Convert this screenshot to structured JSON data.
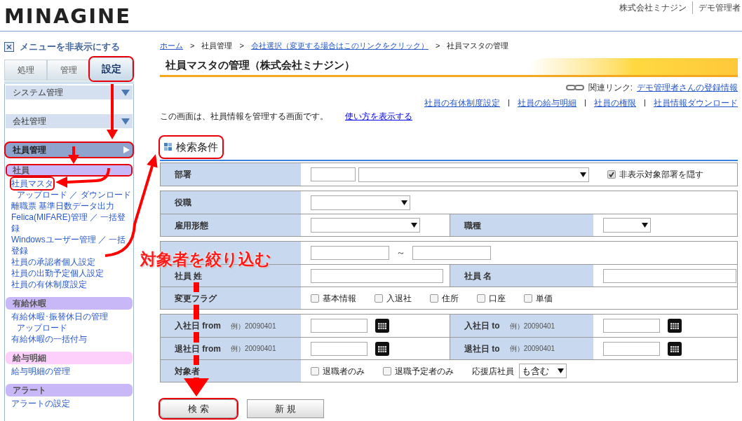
{
  "header": {
    "logo": "MINAGINE",
    "company": "株式会社ミナジン",
    "user": "デモ管理者"
  },
  "sidebar": {
    "hide_menu": "メニューを非表示にする",
    "tabs": [
      {
        "label": "処理",
        "selected": false,
        "highlighted": false
      },
      {
        "label": "管理",
        "selected": false,
        "highlighted": false
      },
      {
        "label": "設定",
        "selected": true,
        "highlighted": true
      }
    ],
    "menus": [
      {
        "label": "システム管理",
        "selected": false,
        "highlighted": false
      },
      {
        "label": "会社管理",
        "selected": false,
        "highlighted": false
      },
      {
        "label": "社員管理",
        "selected": true,
        "highlighted": true
      }
    ],
    "categories": [
      {
        "title": "社員",
        "color": "#c9b8f8",
        "highlighted": true,
        "items": [
          {
            "label": "社員マスタ",
            "highlighted": true,
            "children": [
              {
                "label": "アップロード ／ ダウンロード"
              }
            ]
          },
          {
            "label": "離職票 基準日数データ出力"
          },
          {
            "label": "Felica(MIFARE)管理 ／ 一括登録"
          },
          {
            "label": "Windowsユーザー管理 ／ 一括登録"
          },
          {
            "label": "社員の承認者個人設定"
          },
          {
            "label": "社員の出勤予定個人設定"
          },
          {
            "label": "社員の有休制度設定"
          }
        ]
      },
      {
        "title": "有給休暇",
        "color": "#c9b8f8",
        "highlighted": false,
        "items": [
          {
            "label": "有給休暇･振替休日の管理",
            "children": [
              {
                "label": "アップロード"
              }
            ]
          },
          {
            "label": "有給休暇の一括付与"
          }
        ]
      },
      {
        "title": "給与明細",
        "color": "#fcd0fa",
        "highlighted": false,
        "items": [
          {
            "label": "給与明細の管理"
          }
        ]
      },
      {
        "title": "アラート",
        "color": "#c9b8f8",
        "highlighted": false,
        "items": [
          {
            "label": "アラートの設定"
          }
        ]
      }
    ]
  },
  "breadcrumb": {
    "separator": ">",
    "items": [
      {
        "label": "ホーム",
        "link": true
      },
      {
        "label": "社員管理",
        "link": false
      },
      {
        "label": "会社選択（変更する場合はこのリンクをクリック）",
        "link": true
      },
      {
        "label": "社員マスタの管理",
        "link": false
      }
    ]
  },
  "page_title": "社員マスタの管理（株式会社ミナジン）",
  "related": {
    "label": "関連リンク:",
    "link": "デモ管理者さんの登録情報",
    "links": [
      "社員の有休制度設定",
      "社員の給与明細",
      "社員の権限",
      "社員情報ダウンロード"
    ]
  },
  "description": {
    "text": "この画面は、社員情報を管理する画面です。",
    "link": "使い方を表示する"
  },
  "search": {
    "title": "検索条件",
    "highlighted": true,
    "groups": [
      {
        "rows": [
          {
            "fields": [
              {
                "label": "部署",
                "controls": [
                  {
                    "kind": "input"
                  },
                  {
                    "kind": "select"
                  },
                  {
                    "kind": "checkbox",
                    "label": "非表示対象部署を隠す",
                    "checked": true
                  }
                ]
              }
            ]
          }
        ]
      },
      {
        "rows": [
          {
            "fields": [
              {
                "label": "役職",
                "controls": [
                  {
                    "kind": "select"
                  }
                ]
              }
            ]
          },
          {
            "fields": [
              {
                "label": "雇用形態",
                "controls": [
                  {
                    "kind": "select"
                  }
                ]
              },
              {
                "label": "職種",
                "controls": [
                  {
                    "kind": "select"
                  }
                ]
              }
            ]
          }
        ]
      },
      {
        "rows": [
          {
            "fields": [
              {
                "controls": [
                  {
                    "kind": "input"
                  },
                  {
                    "kind": "separator",
                    "text": "～"
                  },
                  {
                    "kind": "input"
                  }
                ]
              }
            ]
          },
          {
            "fields": [
              {
                "label": "社員 姓",
                "controls": [
                  {
                    "kind": "input"
                  }
                ]
              },
              {
                "label": "社員 名",
                "controls": [
                  {
                    "kind": "input"
                  }
                ]
              }
            ]
          },
          {
            "fields": [
              {
                "label": "変更フラグ",
                "controls": [
                  {
                    "kind": "checkbox",
                    "label": "基本情報",
                    "checked": false
                  },
                  {
                    "kind": "checkbox",
                    "label": "入退社",
                    "checked": false
                  },
                  {
                    "kind": "checkbox",
                    "label": "住所",
                    "checked": false
                  },
                  {
                    "kind": "checkbox",
                    "label": "口座",
                    "checked": false
                  },
                  {
                    "kind": "checkbox",
                    "label": "単価",
                    "checked": false
                  }
                ]
              }
            ]
          }
        ]
      },
      {
        "rows": [
          {
            "fields": [
              {
                "label": "入社日 from",
                "example": "例）20090401",
                "controls": [
                  {
                    "kind": "date"
                  }
                ]
              },
              {
                "label": "入社日 to",
                "example": "例）20090401",
                "controls": [
                  {
                    "kind": "date"
                  }
                ]
              }
            ]
          },
          {
            "fields": [
              {
                "label": "退社日 from",
                "example": "例）20090401",
                "controls": [
                  {
                    "kind": "date"
                  }
                ]
              },
              {
                "label": "退社日 to",
                "example": "例）20090401",
                "controls": [
                  {
                    "kind": "date"
                  }
                ]
              }
            ]
          },
          {
            "fields": [
              {
                "label": "対象者",
                "controls": [
                  {
                    "kind": "checkbox",
                    "label": "退職者のみ",
                    "checked": false
                  },
                  {
                    "kind": "checkbox",
                    "label": "退職予定者のみ",
                    "checked": false
                  },
                  {
                    "kind": "select",
                    "label": "応援店社員",
                    "value": "も含む"
                  }
                ]
              }
            ]
          }
        ]
      }
    ]
  },
  "buttons": [
    {
      "label": "検 索",
      "highlighted": true
    },
    {
      "label": "新 規",
      "highlighted": false
    }
  ],
  "annotation": {
    "callout": "対象者を絞り込む"
  }
}
